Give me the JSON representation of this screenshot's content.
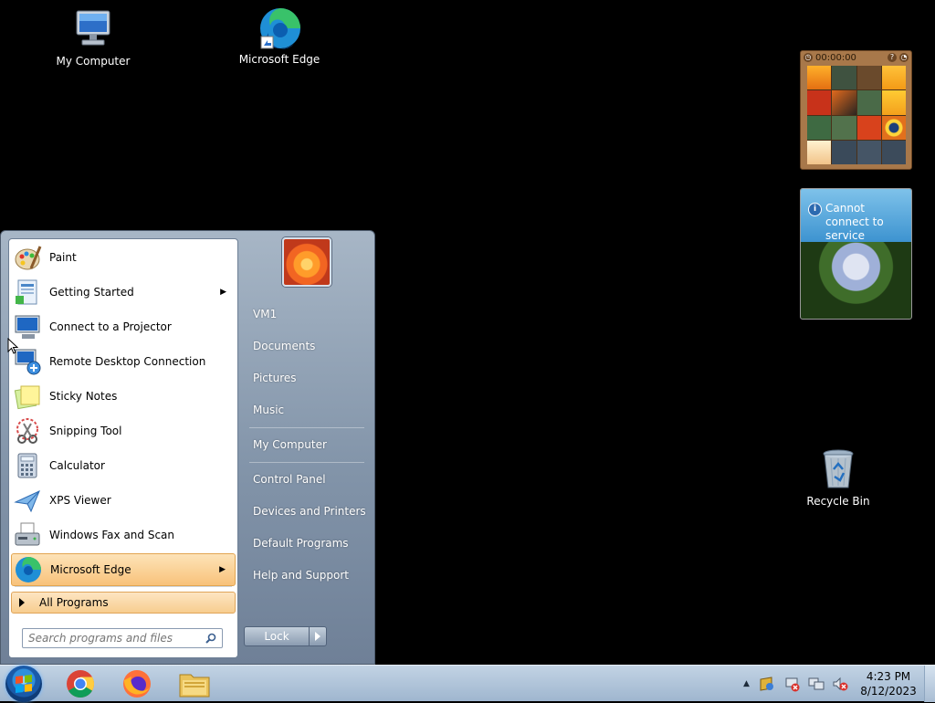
{
  "desktop": {
    "icons": [
      {
        "label": "My Computer"
      },
      {
        "label": "Microsoft Edge"
      },
      {
        "label": "Recycle Bin"
      }
    ]
  },
  "gadgets": {
    "puzzle": {
      "timer": "00:00:00",
      "help_glyph": "?"
    },
    "slideshow": {
      "message": "Cannot connect to service",
      "info_glyph": "i"
    }
  },
  "start_menu": {
    "pinned_programs": [
      {
        "label": "Paint",
        "icon": "paint-icon",
        "has_submenu": false
      },
      {
        "label": "Getting Started",
        "icon": "getting-started-icon",
        "has_submenu": true
      },
      {
        "label": "Connect to a Projector",
        "icon": "projector-icon",
        "has_submenu": false
      },
      {
        "label": "Remote Desktop Connection",
        "icon": "remote-desktop-icon",
        "has_submenu": false
      },
      {
        "label": "Sticky Notes",
        "icon": "sticky-notes-icon",
        "has_submenu": false
      },
      {
        "label": "Snipping Tool",
        "icon": "snipping-tool-icon",
        "has_submenu": false
      },
      {
        "label": "Calculator",
        "icon": "calculator-icon",
        "has_submenu": false
      },
      {
        "label": "XPS Viewer",
        "icon": "xps-viewer-icon",
        "has_submenu": false
      },
      {
        "label": "Windows Fax and Scan",
        "icon": "fax-scan-icon",
        "has_submenu": false
      },
      {
        "label": "Microsoft Edge",
        "icon": "edge-icon",
        "has_submenu": true,
        "highlighted": true
      }
    ],
    "all_programs_label": "All Programs",
    "search_placeholder": "Search programs and files",
    "right_items": [
      {
        "label": "VM1"
      },
      {
        "label": "Documents"
      },
      {
        "label": "Pictures"
      },
      {
        "label": "Music"
      },
      {
        "label": "My Computer"
      },
      {
        "label": "Control Panel"
      },
      {
        "label": "Devices and Printers"
      },
      {
        "label": "Default Programs"
      },
      {
        "label": "Help and Support"
      }
    ],
    "lock_label": "Lock"
  },
  "taskbar": {
    "pinned": [
      "chrome-icon",
      "firefox-icon",
      "file-explorer-icon"
    ],
    "clock": {
      "time": "4:23 PM",
      "date": "8/12/2023"
    }
  },
  "colors": {
    "desktop_bg": "#000000",
    "highlight": "#f8c27a",
    "start_menu_glass": "#8294a9"
  }
}
